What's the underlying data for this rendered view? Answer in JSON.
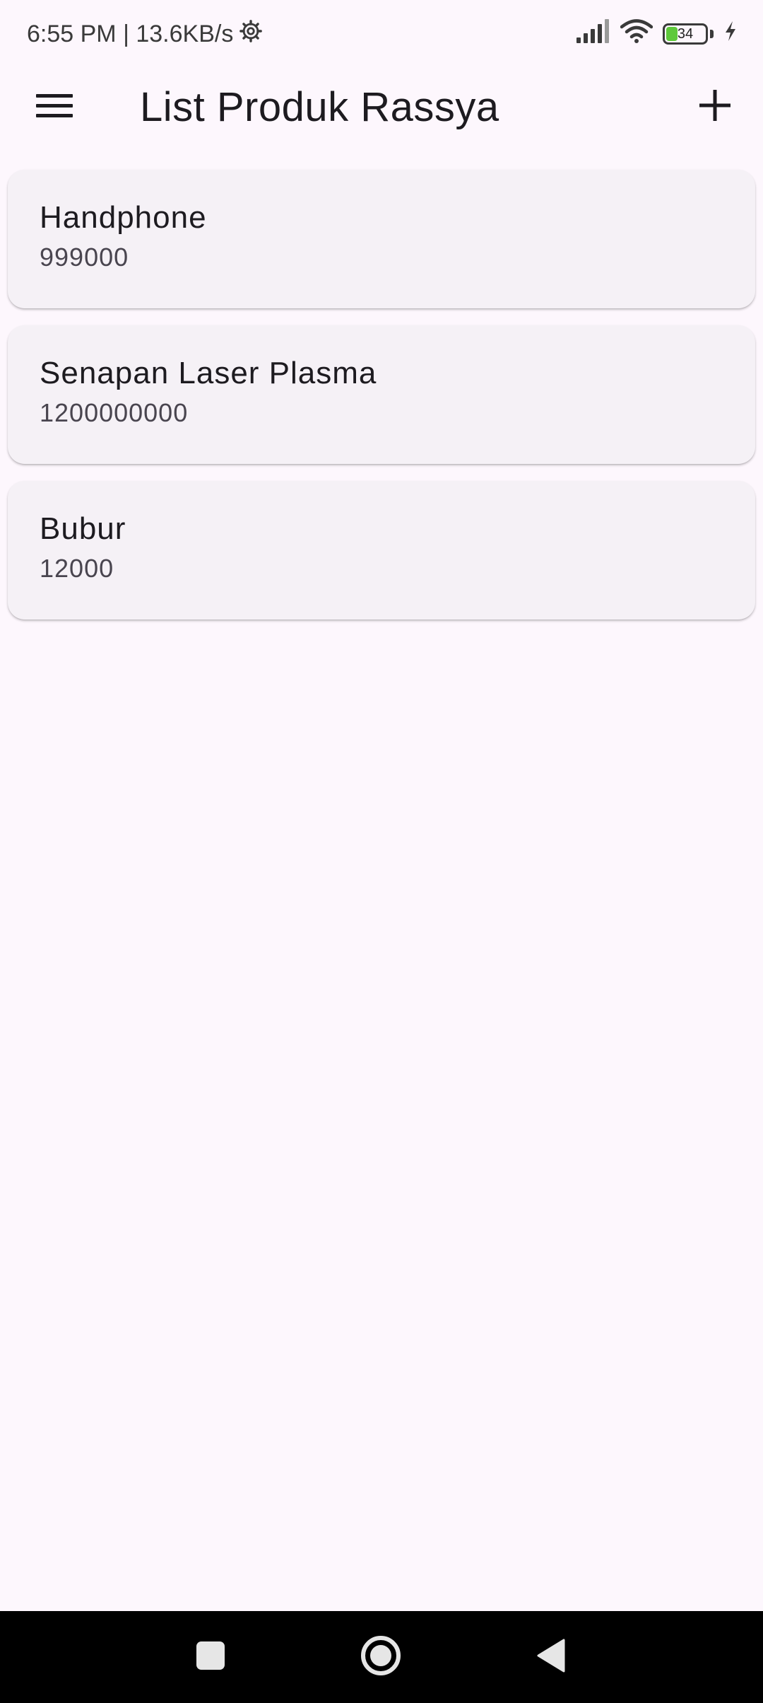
{
  "status_bar": {
    "time_speed": "6:55 PM | 13.6KB/s",
    "settings_icon": "gear-icon",
    "signal_icon": "signal-icon",
    "wifi_icon": "wifi-icon",
    "battery_level": "34",
    "charging_icon": "bolt-icon"
  },
  "app_bar": {
    "menu_icon": "menu-icon",
    "title": "List Produk Rassya",
    "add_icon": "plus-icon"
  },
  "products": [
    {
      "name": "Handphone",
      "price": "999000"
    },
    {
      "name": "Senapan Laser Plasma",
      "price": "1200000000"
    },
    {
      "name": "Bubur",
      "price": "12000"
    }
  ],
  "nav_bar": {
    "recents_icon": "square-icon",
    "home_icon": "circle-icon",
    "back_icon": "triangle-back-icon"
  },
  "colors": {
    "background": "#fdf7fd",
    "card": "#f5f1f6",
    "battery_fill": "#5ec93b",
    "nav_bar": "#000000"
  }
}
